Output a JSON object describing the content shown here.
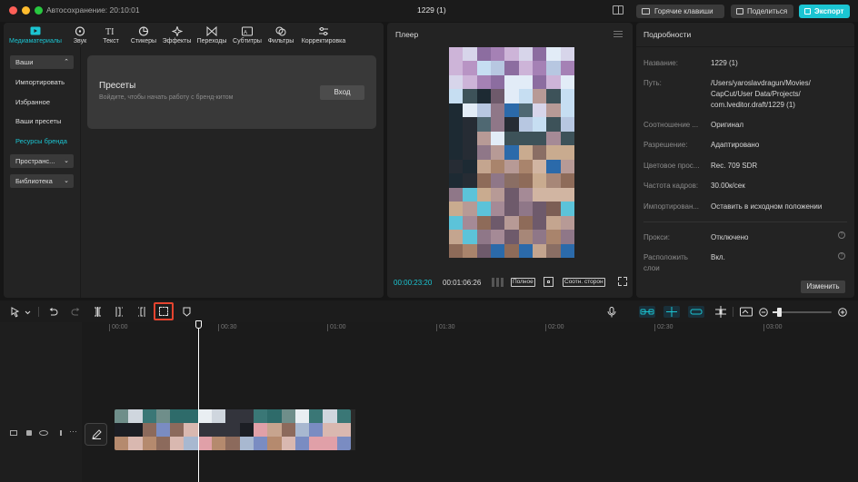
{
  "titlebar": {
    "autosave": "Автосохранение: 20:10:01",
    "project_title": "1229 (1)",
    "hotkeys_label": "Горячие клавиши",
    "share_label": "Поделиться",
    "export_label": "Экспорт",
    "colors": {
      "close": "#fe5f57",
      "minimize": "#febc2e",
      "maximize": "#28c840",
      "accent": "#1bc5d2"
    }
  },
  "toolbar": {
    "items": [
      {
        "label": "Медиаматериалы",
        "icon": "media-icon",
        "active": true
      },
      {
        "label": "Звук",
        "icon": "audio-icon"
      },
      {
        "label": "Текст",
        "icon": "text-icon"
      },
      {
        "label": "Стикеры",
        "icon": "sticker-icon"
      },
      {
        "label": "Эффекты",
        "icon": "effects-icon"
      },
      {
        "label": "Переходы",
        "icon": "transitions-icon"
      },
      {
        "label": "Субтитры",
        "icon": "subtitles-icon"
      },
      {
        "label": "Фильтры",
        "icon": "filters-icon"
      },
      {
        "label": "Корректировка",
        "icon": "adjust-icon"
      }
    ]
  },
  "sidebar": {
    "items": [
      {
        "label": "Ваши",
        "type": "section-open"
      },
      {
        "label": "Импортировать"
      },
      {
        "label": "Избранное"
      },
      {
        "label": "Ваши пресеты"
      },
      {
        "label": "Ресурсы бренда",
        "active": true
      },
      {
        "label": "Пространс...",
        "type": "section"
      },
      {
        "label": "Библиотека",
        "type": "section"
      }
    ]
  },
  "presets": {
    "title": "Пресеты",
    "subtitle": "Войдите, чтобы начать работу с бренд-китом",
    "login_label": "Вход"
  },
  "player": {
    "title": "Плеер",
    "current_time": "00:00:23:20",
    "total_time": "00:01:06:26",
    "full_label": "Полное",
    "ratio_label": "Соотн. сторон"
  },
  "details": {
    "title": "Подробности",
    "rows": [
      {
        "label": "Название:",
        "value": "1229 (1)"
      },
      {
        "label": "Путь:",
        "value_lines": [
          "/Users/yaroslavdragun/Movies/",
          "CapCut/User Data/Projects/",
          "com.lveditor.draft/1229 (1)"
        ]
      },
      {
        "label": "Соотношение ...",
        "value": "Оригинал"
      },
      {
        "label": "Разрешение:",
        "value": "Адаптировано"
      },
      {
        "label": "Цветовое прос...",
        "value": "Rec. 709 SDR"
      },
      {
        "label": "Частота кадров:",
        "value": "30.00к/сек"
      },
      {
        "label": "Импортирован...",
        "value": "Оставить в исходном положении"
      },
      {
        "label": "Прокси:",
        "value": "Отключено"
      },
      {
        "label_lines": [
          "Расположить",
          "слои"
        ],
        "value": "Вкл."
      }
    ],
    "edit_label": "Изменить"
  },
  "timeline": {
    "ruler": [
      "00:00",
      "00:30",
      "01:00",
      "01:30",
      "02:00",
      "02:30",
      "03:00"
    ]
  }
}
